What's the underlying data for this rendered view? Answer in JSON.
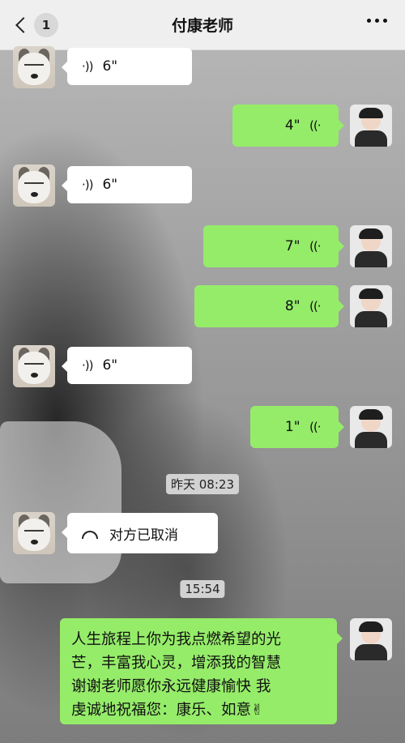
{
  "header": {
    "back_badge": "1",
    "title": "付康老师"
  },
  "messages": [
    {
      "side": "in",
      "type": "voice",
      "duration": "6\""
    },
    {
      "side": "out",
      "type": "voice",
      "duration": "4\""
    },
    {
      "side": "in",
      "type": "voice",
      "duration": "6\""
    },
    {
      "side": "out",
      "type": "voice",
      "duration": "7\""
    },
    {
      "side": "out",
      "type": "voice",
      "duration": "8\""
    },
    {
      "side": "in",
      "type": "voice",
      "duration": "6\""
    },
    {
      "side": "out",
      "type": "voice",
      "duration": "1\""
    },
    {
      "type": "timestamp",
      "text": "昨天 08:23"
    },
    {
      "side": "in",
      "type": "call",
      "text": "对方已取消"
    },
    {
      "type": "timestamp",
      "text": "15:54"
    },
    {
      "side": "out",
      "type": "text",
      "lines": [
        "人生旅程上你为我点燃希望的光",
        "芒，丰富我心灵，增添我的智慧",
        "谢谢老师愿你永远健康愉快  我",
        "虔诚地祝福您：康乐、如意"
      ],
      "emoji": "✌"
    }
  ],
  "icons": {
    "voice": "voice-wave-icon",
    "call": "phone-hangup-icon",
    "more": "more-dots-icon",
    "back": "chevron-left-icon"
  },
  "colors": {
    "outgoing_bubble": "#95ec69",
    "incoming_bubble": "#ffffff",
    "header_bg": "#efefef"
  }
}
